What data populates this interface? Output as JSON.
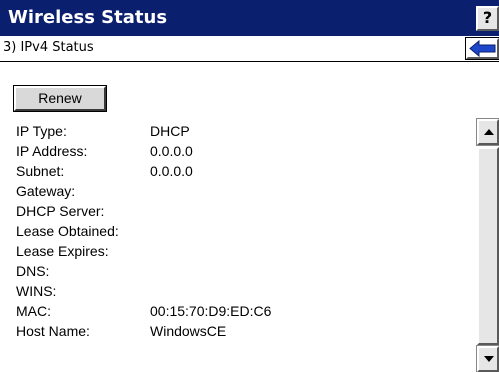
{
  "window": {
    "title": "Wireless Status",
    "help_label": "?"
  },
  "breadcrumb": {
    "text": "3) IPv4 Status"
  },
  "actions": {
    "renew_label": "Renew"
  },
  "ipv4": [
    {
      "label": "IP Type:",
      "value": "DHCP"
    },
    {
      "label": "IP Address:",
      "value": "0.0.0.0"
    },
    {
      "label": "Subnet:",
      "value": "0.0.0.0"
    },
    {
      "label": "Gateway:",
      "value": ""
    },
    {
      "label": "DHCP Server:",
      "value": ""
    },
    {
      "label": "Lease Obtained:",
      "value": ""
    },
    {
      "label": "Lease Expires:",
      "value": ""
    },
    {
      "label": "DNS:",
      "value": ""
    },
    {
      "label": "WINS:",
      "value": ""
    },
    {
      "label": "MAC:",
      "value": "00:15:70:D9:ED:C6"
    },
    {
      "label": "Host Name:",
      "value": "WindowsCE"
    }
  ],
  "icons": {
    "back": "left-arrow-icon",
    "scroll_up": "triangle-up-icon",
    "scroll_down": "triangle-down-icon"
  },
  "colors": {
    "titlebar": "#0a1f6e",
    "arrow": "#1e46c8"
  }
}
